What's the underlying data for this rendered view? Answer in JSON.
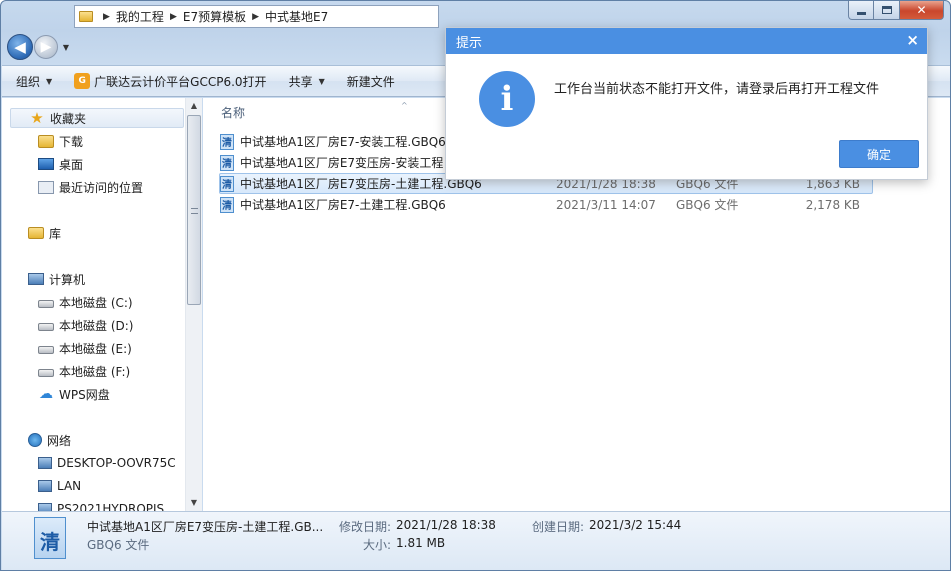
{
  "window": {
    "min_glyph": "",
    "close_glyph": "✕"
  },
  "nav": {
    "back_glyph": "◀",
    "forward_glyph": "▶",
    "breadcrumbs": [
      "我的工程",
      "E7预算模板",
      "中式基地E7"
    ]
  },
  "toolbar": {
    "organize": "组织",
    "open_with": "广联达云计价平台GCCP6.0打开",
    "share": "共享",
    "new_folder": "新建文件"
  },
  "sidebar": {
    "favorites": "收藏夹",
    "downloads": "下载",
    "desktop": "桌面",
    "recent": "最近访问的位置",
    "libraries": "库",
    "computer": "计算机",
    "drive_c": "本地磁盘 (C:)",
    "drive_d": "本地磁盘 (D:)",
    "drive_e": "本地磁盘 (E:)",
    "drive_f": "本地磁盘 (F:)",
    "wps": "WPS网盘",
    "network": "网络",
    "pc1": "DESKTOP-OOVR75C",
    "pc2": "LAN",
    "pc3": "PS2021HYDROPIS"
  },
  "filelist": {
    "column_name": "名称",
    "icon_glyph": "清",
    "files": [
      {
        "name": "中试基地A1区厂房E7-安装工程.GBQ6",
        "date": "",
        "type": "",
        "size": ""
      },
      {
        "name": "中试基地A1区厂房E7变压房-安装工程",
        "date": "",
        "type": "",
        "size": ""
      },
      {
        "name": "中试基地A1区厂房E7变压房-土建工程.GBQ6",
        "date": "2021/1/28 18:38",
        "type": "GBQ6 文件",
        "size": "1,863 KB"
      },
      {
        "name": "中试基地A1区厂房E7-土建工程.GBQ6",
        "date": "2021/3/11 14:07",
        "type": "GBQ6 文件",
        "size": "2,178 KB"
      }
    ]
  },
  "details": {
    "filename": "中试基地A1区厂房E7变压房-土建工程.GB...",
    "filetype": "GBQ6 文件",
    "modified_label": "修改日期:",
    "modified_value": "2021/1/28 18:38",
    "created_label": "创建日期:",
    "created_value": "2021/3/2 15:44",
    "size_label": "大小:",
    "size_value": "1.81 MB"
  },
  "dialog": {
    "title": "提示",
    "close": "×",
    "icon": "i",
    "message": "工作台当前状态不能打开文件，请登录后再打开工程文件",
    "ok": "确定",
    "accent": "#4a8fe2"
  }
}
